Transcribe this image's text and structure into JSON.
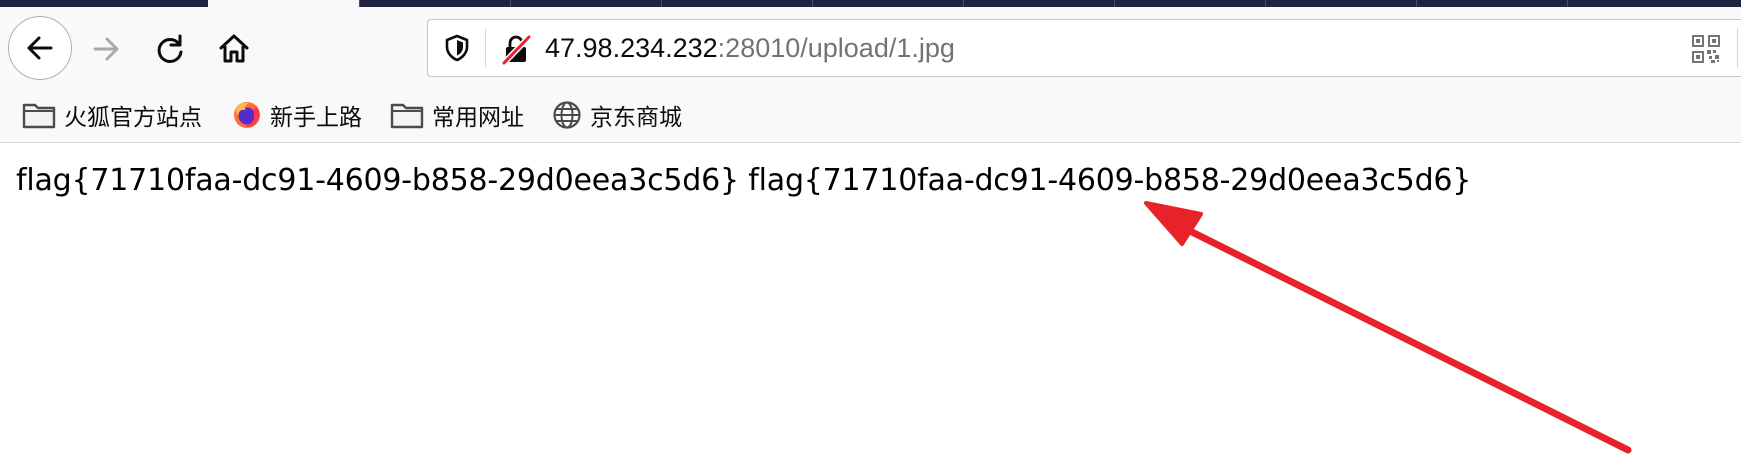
{
  "window": {
    "tab_count": 10
  },
  "navigation": {
    "back_icon": "arrow-left-icon",
    "forward_icon": "arrow-right-icon",
    "reload_icon": "reload-icon",
    "home_icon": "home-icon"
  },
  "urlbar": {
    "host": "47.98.234.232",
    "rest": ":28010/upload/1.jpg",
    "tracking_icon": "shield-icon",
    "security_icon": "insecure-lock-icon",
    "qr_icon": "qr-code-icon"
  },
  "bookmarks": {
    "items": [
      {
        "label": "火狐官方站点",
        "icon": "folder-icon"
      },
      {
        "label": "新手上路",
        "icon": "firefox-icon"
      },
      {
        "label": "常用网址",
        "icon": "folder-icon"
      },
      {
        "label": "京东商城",
        "icon": "globe-icon"
      }
    ]
  },
  "page": {
    "content": "flag{71710faa-dc91-4609-b858-29d0eea3c5d6} flag{71710faa-dc91-4609-b858-29d0eea3c5d6}"
  },
  "annotation": {
    "arrow_color": "#e8222a"
  },
  "colors": {
    "tabstrip": "#202340",
    "toolbar": "#f9f9fa",
    "url_host": "#0c0c0d",
    "url_rest": "#737373",
    "insecure_slash": "#e8222a"
  }
}
